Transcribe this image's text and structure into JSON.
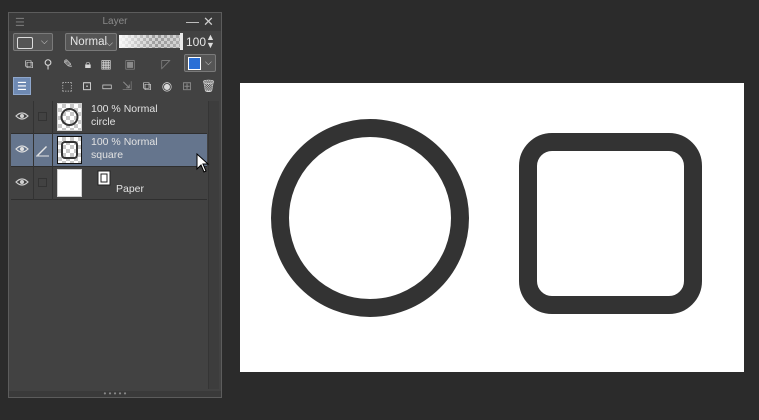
{
  "panel": {
    "title": "Layer",
    "blend_mode": "Normal",
    "opacity": "100",
    "layers": [
      {
        "opacity_mode": "100 % Normal",
        "name": "circle",
        "selected": false
      },
      {
        "opacity_mode": "100 % Normal",
        "name": "square",
        "selected": true
      },
      {
        "name": "Paper"
      }
    ]
  },
  "canvas": {
    "background_color": "#ffffff",
    "shape_color": "#333333",
    "shapes": [
      "circle",
      "rounded-square"
    ]
  },
  "colors": {
    "selection": "#65758d",
    "panel_bg": "#424242",
    "app_bg": "#2b2b2b"
  }
}
